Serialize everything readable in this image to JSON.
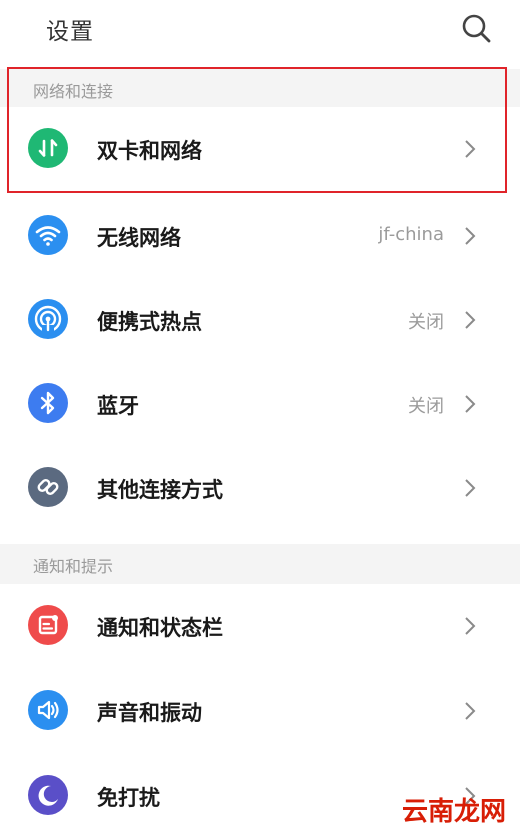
{
  "header": {
    "title": "设置"
  },
  "sections": [
    {
      "title": "网络和连接",
      "items": [
        {
          "label": "双卡和网络",
          "value": ""
        },
        {
          "label": "无线网络",
          "value": "jf-china"
        },
        {
          "label": "便携式热点",
          "value": "关闭"
        },
        {
          "label": "蓝牙",
          "value": "关闭"
        },
        {
          "label": "其他连接方式",
          "value": ""
        }
      ]
    },
    {
      "title": "通知和提示",
      "items": [
        {
          "label": "通知和状态栏",
          "value": ""
        },
        {
          "label": "声音和振动",
          "value": ""
        },
        {
          "label": "免打扰",
          "value": ""
        }
      ]
    }
  ],
  "watermark": "云南龙网",
  "colors": {
    "dual_sim": "#1fb874",
    "wifi": "#2b8ff0",
    "hotspot": "#2b8ff0",
    "bluetooth": "#3d7cf0",
    "other_connection": "#5b6a80",
    "notification": "#ef4b4b",
    "sound": "#2b8ff0",
    "dnd": "#5a4fc8",
    "highlight": "#e0242a"
  },
  "icons": [
    "search-icon",
    "dual-sim-icon",
    "wifi-icon",
    "hotspot-icon",
    "bluetooth-icon",
    "link-icon",
    "notification-icon",
    "sound-icon",
    "moon-icon",
    "chevron-right-icon"
  ]
}
